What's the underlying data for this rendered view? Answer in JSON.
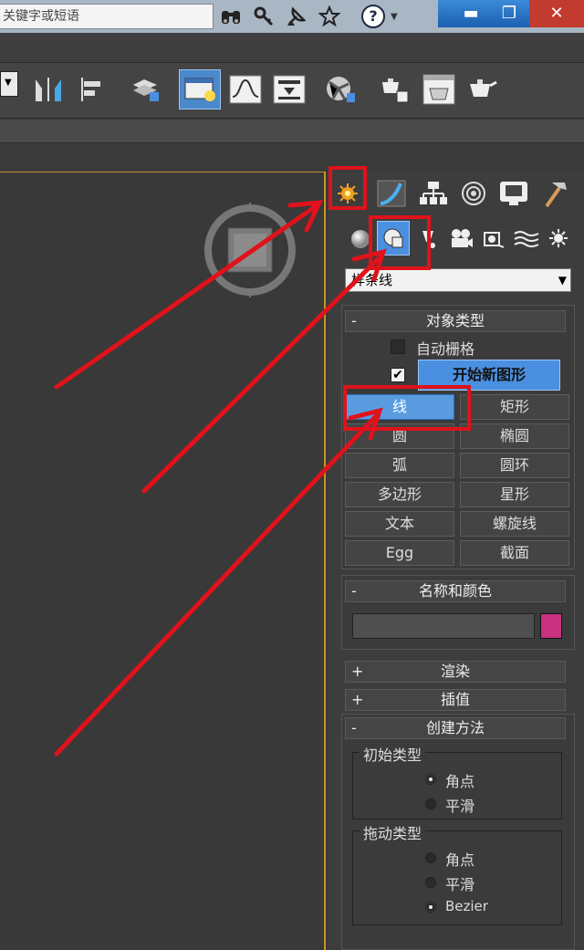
{
  "titlebar": {
    "search_placeholder": "关键字或短语",
    "window_buttons": [
      "minimize",
      "restore",
      "close"
    ]
  },
  "toolbar": {
    "tools": [
      "mirror-icon",
      "align-icon",
      "layer-manager-icon",
      "scene-explorer-icon",
      "curve-editor-icon",
      "schematic-view-icon",
      "material-editor-icon",
      "render-setup-icon",
      "rendered-frame-window-icon",
      "render-production-icon"
    ],
    "active_tool": "scene-explorer-icon"
  },
  "command_panel": {
    "tabs": [
      "create-icon",
      "modify-icon",
      "hierarchy-icon",
      "motion-icon",
      "display-icon",
      "utilities-icon"
    ],
    "active_tab": "create-icon",
    "sub_categories": [
      "geometry-icon",
      "shapes-icon",
      "lights-icon",
      "cameras-icon",
      "helpers-icon",
      "space-warps-icon",
      "systems-icon"
    ],
    "active_sub_category": "shapes-icon",
    "category_value": "样条线",
    "object_type": {
      "header": "对象类型",
      "autogrid_label": "自动栅格",
      "start_new_shape_label": "开始新图形",
      "buttons": [
        [
          "线",
          "矩形"
        ],
        [
          "圆",
          "椭圆"
        ],
        [
          "弧",
          "圆环"
        ],
        [
          "多边形",
          "星形"
        ],
        [
          "文本",
          "螺旋线"
        ],
        [
          "Egg",
          "截面"
        ]
      ],
      "active_button": "线"
    },
    "name_color": {
      "header": "名称和颜色",
      "name_value": "",
      "swatch_color": "#c8327e"
    },
    "rendering": {
      "header": "渲染",
      "sign": "+"
    },
    "interpolation": {
      "header": "插值",
      "sign": "+"
    },
    "creation_method": {
      "header": "创建方法",
      "sign": "-",
      "initial_type": {
        "title": "初始类型",
        "options": [
          "角点",
          "平滑"
        ],
        "selected": "角点"
      },
      "drag_type": {
        "title": "拖动类型",
        "options": [
          "角点",
          "平滑",
          "Bezier"
        ],
        "selected": "Bezier"
      }
    }
  },
  "colors": {
    "annotation_red": "#e0121b",
    "viewport_border": "#c8951f",
    "active_blue": "#4a8fe0"
  }
}
